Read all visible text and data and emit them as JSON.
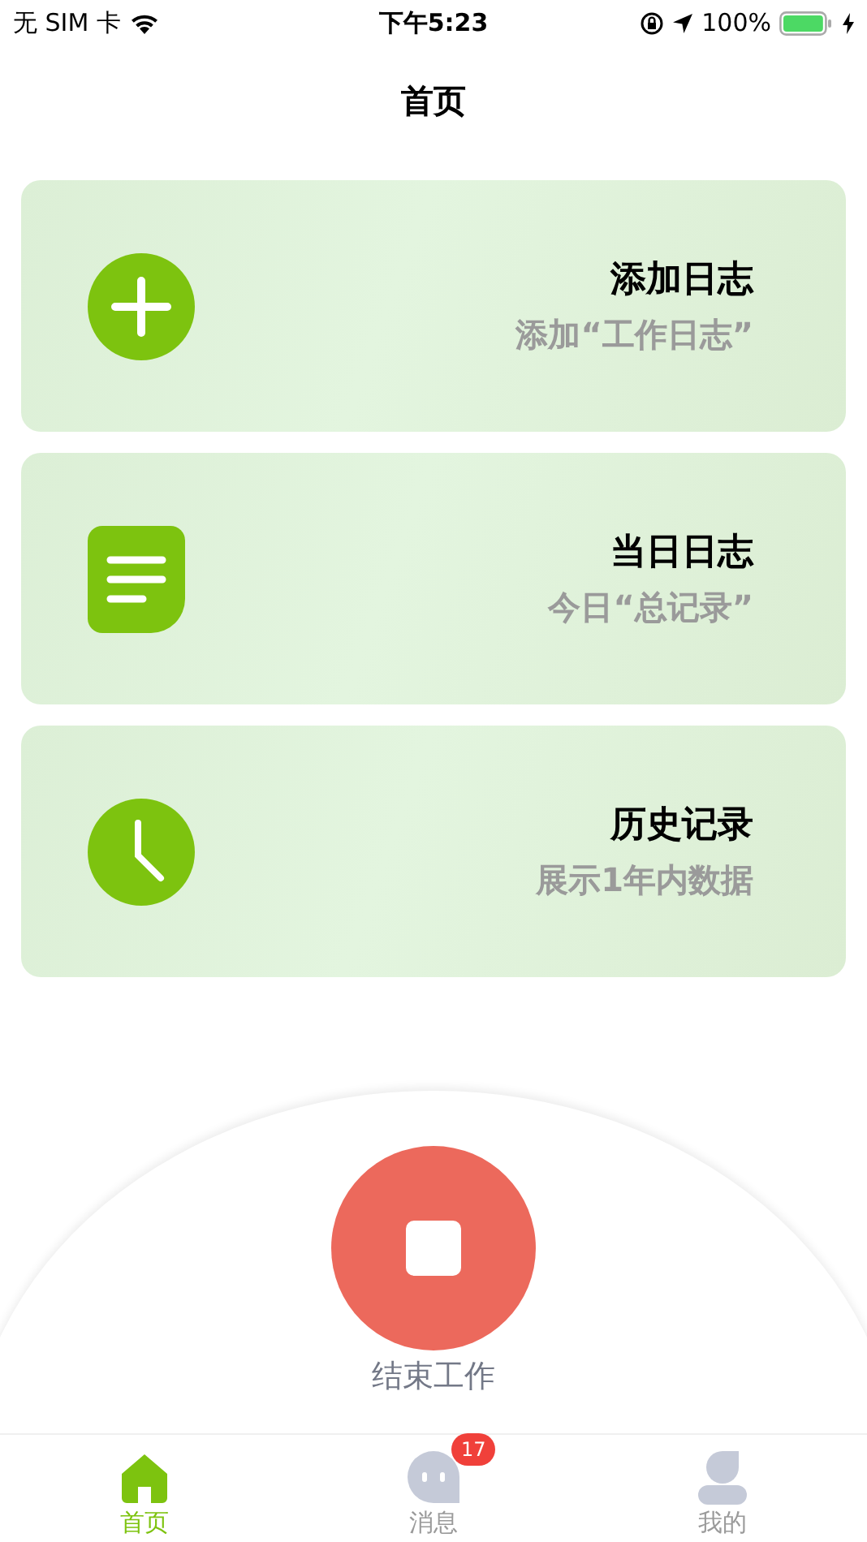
{
  "status_bar": {
    "carrier": "无 SIM 卡",
    "time": "下午5:23",
    "battery": "100%"
  },
  "title": "首页",
  "cards": [
    {
      "kind": "plus",
      "title": "添加日志",
      "subtitle": "添加“工作日志”"
    },
    {
      "kind": "note",
      "title": "当日日志",
      "subtitle": "今日“总记录”"
    },
    {
      "kind": "clock",
      "title": "历史记录",
      "subtitle": "展示1年内数据"
    }
  ],
  "action": {
    "label": "结束工作"
  },
  "tabs": [
    {
      "kind": "home",
      "label": "首页",
      "selected": true
    },
    {
      "kind": "chat",
      "label": "消息",
      "selected": false,
      "badge": "17"
    },
    {
      "kind": "user",
      "label": "我的",
      "selected": false
    }
  ]
}
